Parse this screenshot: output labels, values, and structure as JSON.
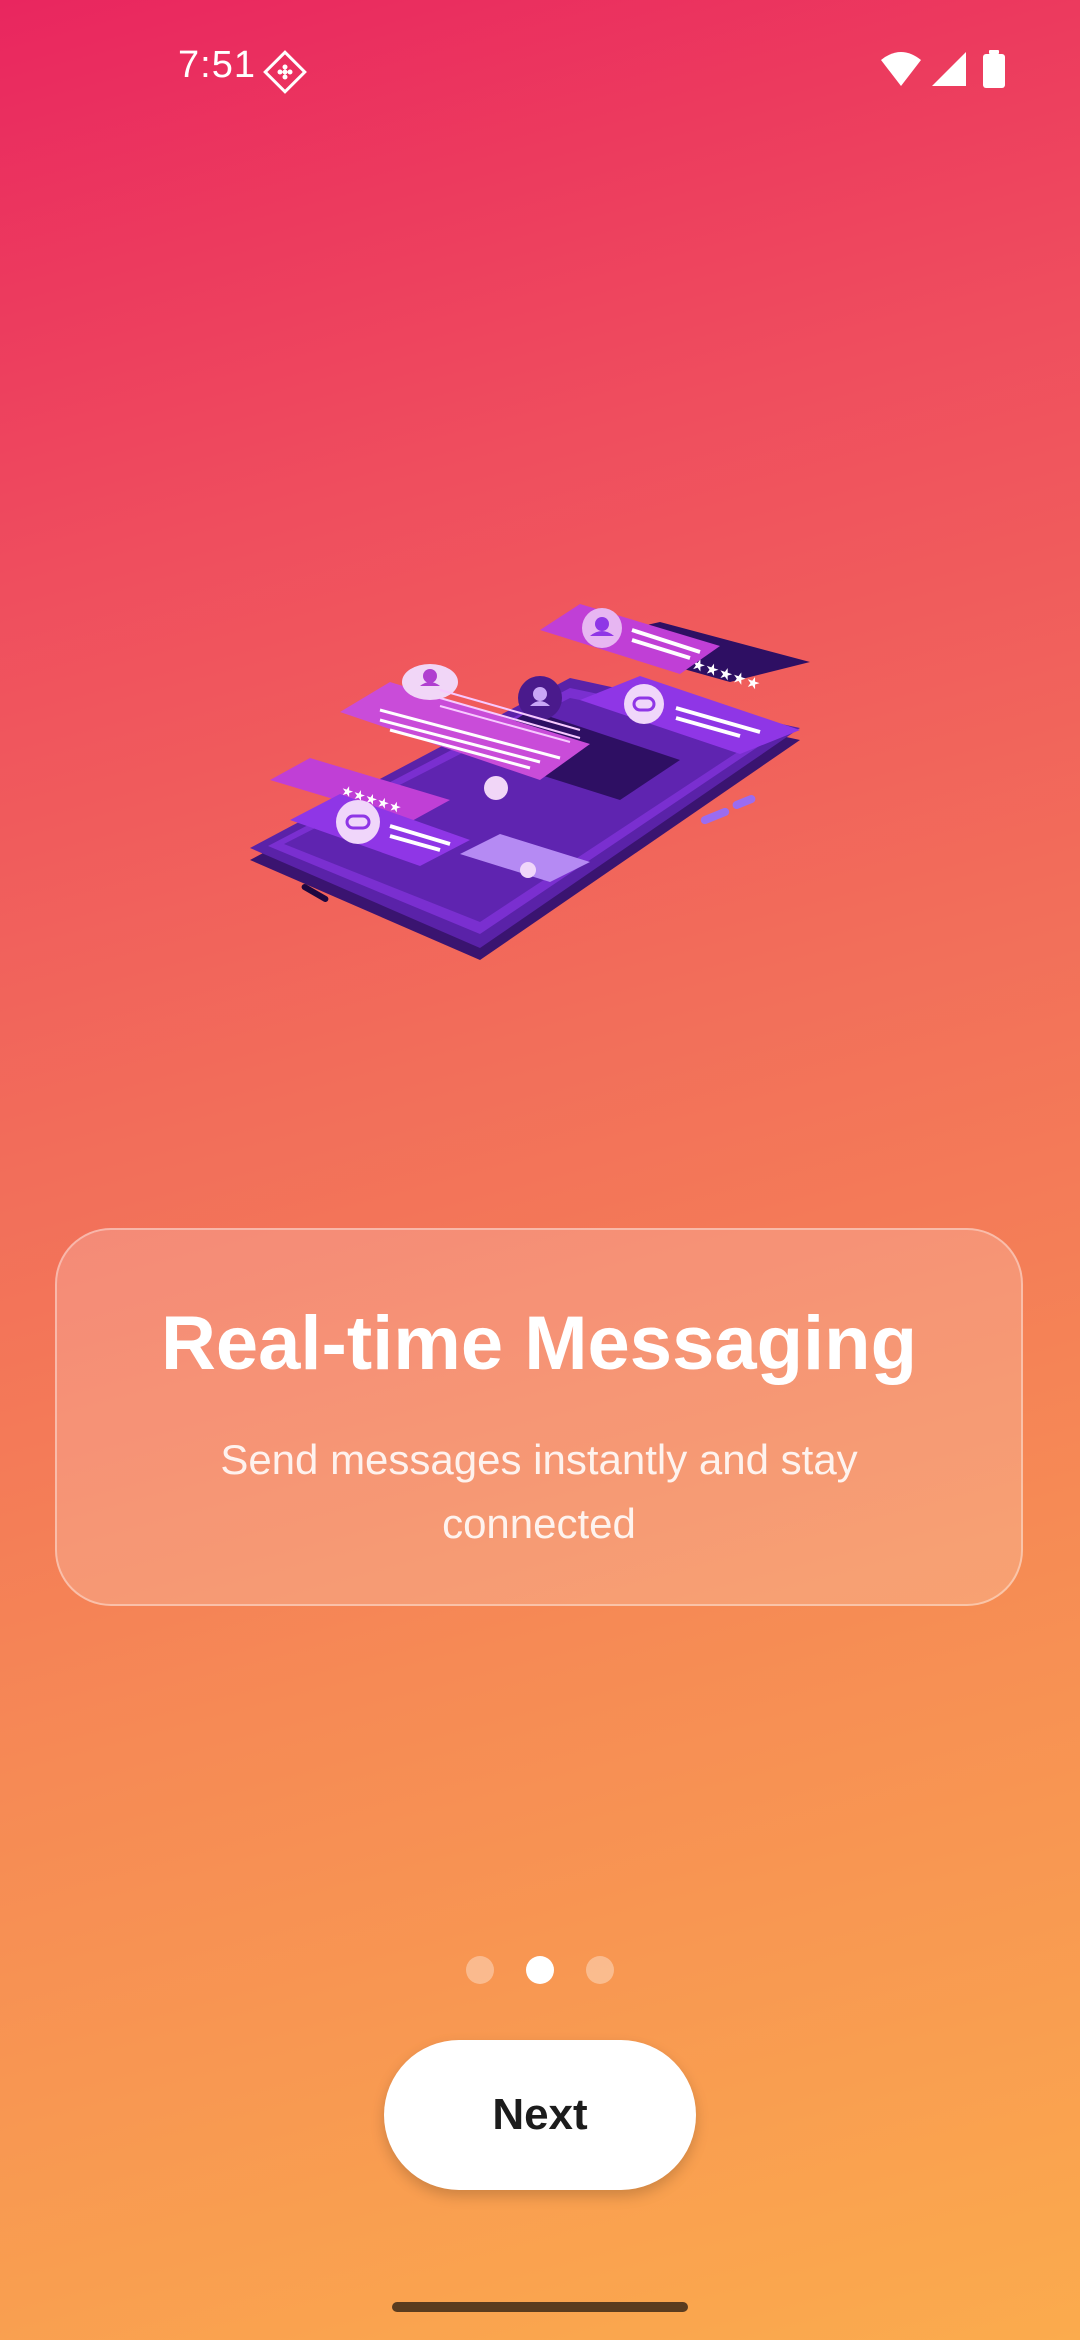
{
  "status_bar": {
    "time": "7:51",
    "app_icon": "notification-app-icon",
    "wifi_icon": "wifi-icon",
    "signal_icon": "cellular-signal-icon",
    "battery_icon": "battery-icon"
  },
  "illustration": {
    "icon": "phone-messaging-illustration",
    "colors": {
      "phone_body": "#4a1a8c",
      "screen": "#6a2bc4",
      "bubble_magenta": "#c03fd6",
      "bubble_violet": "#8f36e6",
      "dark_panel": "#2e0f63"
    }
  },
  "onboarding": {
    "title": "Real-time Messaging",
    "subtitle": "Send messages instantly and stay connected",
    "page_count": 3,
    "current_page": 2
  },
  "actions": {
    "next_label": "Next"
  },
  "colors": {
    "gradient_top": "#e9265f",
    "gradient_bottom": "#fbab4d",
    "button_bg": "#ffffff",
    "button_text": "#1c1c1c"
  }
}
